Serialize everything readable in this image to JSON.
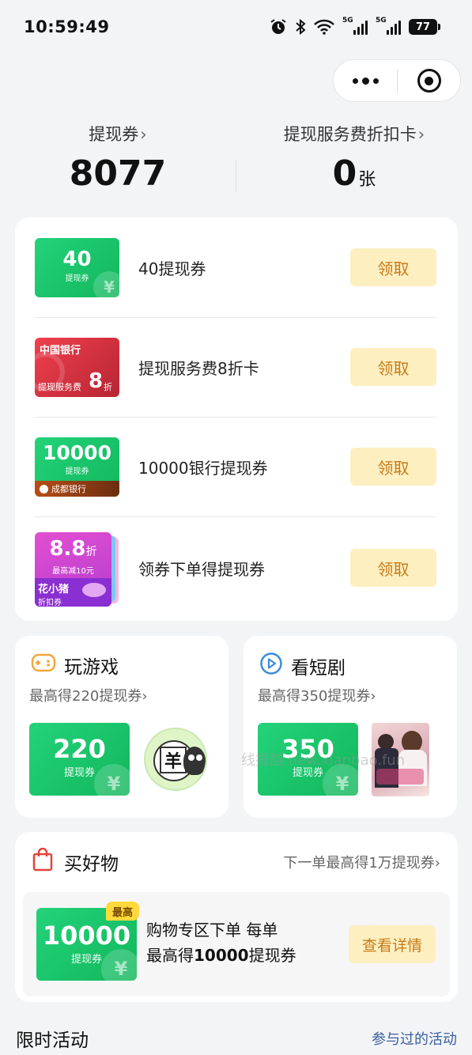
{
  "status_bar": {
    "time": "10:59:49",
    "battery": "77",
    "signal_tag": "5G"
  },
  "summary": {
    "vouchers_label": "提现券",
    "vouchers_value": "8077",
    "discount_card_label": "提现服务费折扣卡",
    "discount_card_value": "0",
    "discount_card_unit": "张",
    "chevron": "›"
  },
  "coupons": [
    {
      "name": "40提现券",
      "button": "领取",
      "thumb": {
        "big": "40",
        "small": "提现券"
      }
    },
    {
      "name": "提现服务费8折卡",
      "button": "领取",
      "thumb": {
        "bank": "中国银行",
        "text": "提现服务费",
        "num": "8",
        "unit": "折"
      }
    },
    {
      "name": "10000银行提现券",
      "button": "领取",
      "thumb": {
        "big": "10000",
        "small": "提现券",
        "bank": "成都银行"
      }
    },
    {
      "name": "领券下单得提现券",
      "button": "领取",
      "thumb": {
        "big": "8.8",
        "unit": "折",
        "small": "最高减10元",
        "brand": "花小猪",
        "brand_sub": "折扣券"
      }
    }
  ],
  "game": {
    "title": "玩游戏",
    "subtitle": "最高得220提现券",
    "value": "220",
    "value_label": "提现券",
    "game_char": "羊"
  },
  "drama": {
    "title": "看短剧",
    "subtitle": "最高得350提现券",
    "value": "350",
    "value_label": "提现券"
  },
  "shop": {
    "title": "买好物",
    "link": "下一单最高得1万提现券",
    "badge": "最高",
    "value": "10000",
    "value_label": "提现券",
    "line1": "购物专区下单 每单",
    "line2_prefix": "最高得",
    "line2_bold": "10000",
    "line2_suffix": "提现券",
    "button": "查看详情"
  },
  "limited": {
    "title": "限时活动",
    "link": "参与过的活动"
  },
  "yen": "¥",
  "watermark": "线报酷 new.xianbao.fun",
  "colors": {
    "green": "#19c46a",
    "claim_bg": "#fdefc0",
    "claim_text": "#c77b19",
    "link_blue": "#3a5fa0"
  }
}
